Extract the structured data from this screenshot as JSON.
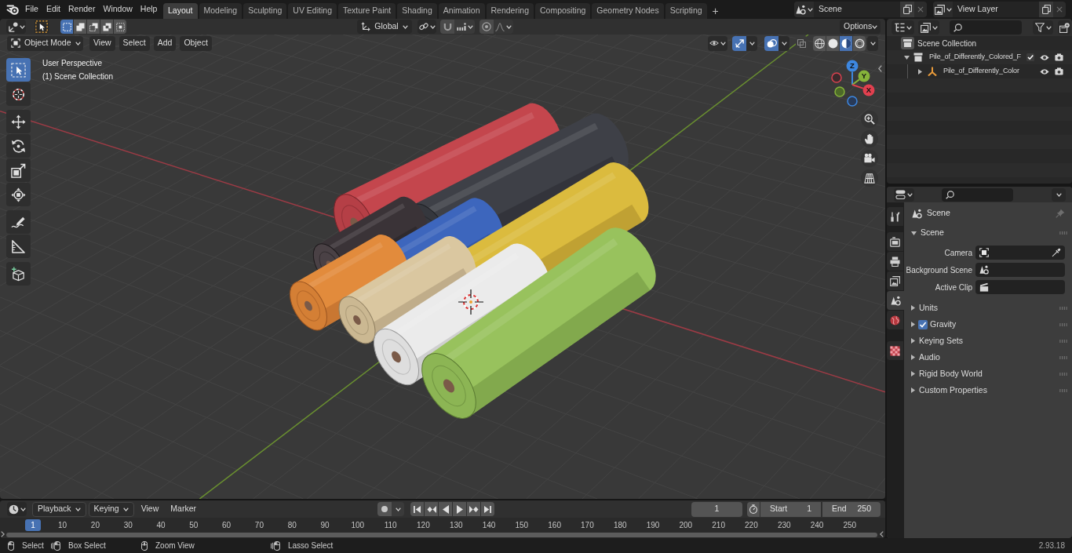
{
  "top_bar": {
    "menus": [
      "File",
      "Edit",
      "Render",
      "Window",
      "Help"
    ],
    "workspaces": [
      {
        "label": "Layout",
        "selected": true
      },
      {
        "label": "Modeling",
        "selected": false
      },
      {
        "label": "Sculpting",
        "selected": false
      },
      {
        "label": "UV Editing",
        "selected": false
      },
      {
        "label": "Texture Paint",
        "selected": false
      },
      {
        "label": "Shading",
        "selected": false
      },
      {
        "label": "Animation",
        "selected": false
      },
      {
        "label": "Rendering",
        "selected": false
      },
      {
        "label": "Compositing",
        "selected": false
      },
      {
        "label": "Geometry Nodes",
        "selected": false
      },
      {
        "label": "Scripting",
        "selected": false
      }
    ],
    "add_workspace": "+",
    "scene": "Scene",
    "view_layer": "View Layer"
  },
  "tool_header": {
    "selection_modes": [
      {
        "kind": "set",
        "selected": true
      },
      {
        "kind": "extend",
        "selected": false
      },
      {
        "kind": "subtract",
        "selected": false
      },
      {
        "kind": "invert",
        "selected": false
      },
      {
        "kind": "intersect",
        "selected": false
      }
    ],
    "orientation": "Global",
    "options": "Options"
  },
  "viewport_header": {
    "mode": "Object Mode",
    "menus": [
      "View",
      "Select",
      "Add",
      "Object"
    ],
    "show_gizmos": true,
    "show_overlays": true,
    "xray": false,
    "shading": [
      {
        "kind": "wireframe",
        "selected": false
      },
      {
        "kind": "solid",
        "selected": false
      },
      {
        "kind": "material",
        "selected": true
      },
      {
        "kind": "rendered",
        "selected": false
      }
    ]
  },
  "viewport": {
    "view_name": "User Perspective",
    "collection": "(1) Scene Collection",
    "tools": [
      {
        "kind": "select",
        "selected": true
      },
      {
        "kind": "cursor",
        "selected": false
      },
      {
        "kind": "move",
        "selected": false
      },
      {
        "kind": "rotate",
        "selected": false
      },
      {
        "kind": "scale",
        "selected": false
      },
      {
        "kind": "transform",
        "selected": false
      },
      {
        "kind": "annotate",
        "selected": false
      },
      {
        "kind": "measure",
        "selected": false
      },
      {
        "kind": "addcube",
        "selected": false
      }
    ],
    "gizmo_axes": [
      {
        "label": "Z"
      },
      {
        "label": "Y"
      },
      {
        "label": "X"
      }
    ]
  },
  "outliner": {
    "root": "Scene Collection",
    "items": [
      {
        "label": "Pile_of_Differently_Colored_F",
        "kind": "collection",
        "expanded": true,
        "checked": true,
        "children": [
          {
            "label": "Pile_of_Differently_Color",
            "kind": "object",
            "expanded": false
          }
        ]
      }
    ]
  },
  "properties": {
    "tabs": [
      {
        "kind": "tool",
        "selected": false
      },
      {
        "kind": "render",
        "selected": false
      },
      {
        "kind": "output",
        "selected": false
      },
      {
        "kind": "viewlayer",
        "selected": false
      },
      {
        "kind": "scene",
        "selected": true
      },
      {
        "kind": "world",
        "selected": false
      },
      {
        "kind": "texture",
        "selected": false
      }
    ],
    "context": "Scene",
    "panel": {
      "title": "Scene",
      "expanded": true,
      "fields": [
        {
          "label": "Camera",
          "kind": "camera"
        },
        {
          "label": "Background Scene",
          "kind": "scene"
        },
        {
          "label": "Active Clip",
          "kind": "clip"
        }
      ]
    },
    "subpanels": [
      {
        "title": "Units",
        "kind": "plain",
        "expanded": false
      },
      {
        "title": "Gravity",
        "kind": "toggle",
        "expanded": false,
        "checked": true
      },
      {
        "title": "Keying Sets",
        "kind": "plain",
        "expanded": false
      },
      {
        "title": "Audio",
        "kind": "plain",
        "expanded": false
      },
      {
        "title": "Rigid Body World",
        "kind": "plain",
        "expanded": false
      },
      {
        "title": "Custom Properties",
        "kind": "plain",
        "expanded": false
      }
    ]
  },
  "timeline": {
    "menus": [
      {
        "label": "Playback",
        "kind": "dropdown"
      },
      {
        "label": "Keying",
        "kind": "dropdown"
      },
      {
        "label": "View",
        "kind": "menu"
      },
      {
        "label": "Marker",
        "kind": "menu"
      }
    ],
    "auto_keying": false,
    "current_frame": "1",
    "start_label": "Start",
    "start": "1",
    "end_label": "End",
    "end": "250",
    "ruler": [
      {
        "label": "1",
        "selected": true
      },
      {
        "label": "10",
        "selected": false
      },
      {
        "label": "20",
        "selected": false
      },
      {
        "label": "30",
        "selected": false
      },
      {
        "label": "40",
        "selected": false
      },
      {
        "label": "50",
        "selected": false
      },
      {
        "label": "60",
        "selected": false
      },
      {
        "label": "70",
        "selected": false
      },
      {
        "label": "80",
        "selected": false
      },
      {
        "label": "90",
        "selected": false
      },
      {
        "label": "100",
        "selected": false
      },
      {
        "label": "110",
        "selected": false
      },
      {
        "label": "120",
        "selected": false
      },
      {
        "label": "130",
        "selected": false
      },
      {
        "label": "140",
        "selected": false
      },
      {
        "label": "150",
        "selected": false
      },
      {
        "label": "160",
        "selected": false
      },
      {
        "label": "170",
        "selected": false
      },
      {
        "label": "180",
        "selected": false
      },
      {
        "label": "190",
        "selected": false
      },
      {
        "label": "200",
        "selected": false
      },
      {
        "label": "210",
        "selected": false
      },
      {
        "label": "220",
        "selected": false
      },
      {
        "label": "230",
        "selected": false
      },
      {
        "label": "240",
        "selected": false
      },
      {
        "label": "250",
        "selected": false
      }
    ]
  },
  "status_bar": {
    "hints": [
      {
        "label": "Select",
        "kind": "click"
      },
      {
        "label": "Box Select",
        "kind": "drag"
      },
      {
        "label": "Zoom View",
        "kind": "middle"
      },
      {
        "label": "Lasso Select",
        "kind": "drag"
      }
    ],
    "version": "2.93.18"
  }
}
